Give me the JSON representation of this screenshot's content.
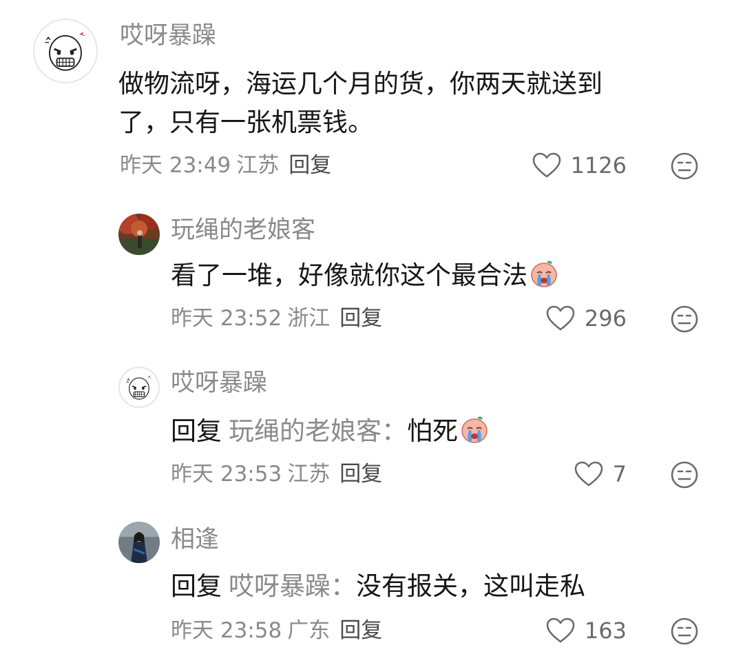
{
  "comments": [
    {
      "username": "哎呀暴躁",
      "text_line1": "做物流呀，海运几个月的货，你两天就送到",
      "text_line2": "了，只有一张机票钱。",
      "time": "昨天 23:49",
      "location": "江苏",
      "reply_label": "回复",
      "likes": "1126",
      "avatar_icon": "angry-face-sketch-avatar"
    },
    {
      "username": "玩绳的老娘客",
      "text": "看了一堆，好像就你这个最合法",
      "emoji": "crying-face-emoji",
      "time": "昨天 23:52",
      "location": "浙江",
      "reply_label": "回复",
      "likes": "296",
      "avatar_icon": "autumn-tree-photo-avatar"
    },
    {
      "username": "哎呀暴躁",
      "reply_prefix": "回复",
      "reply_target": "玩绳的老娘客：",
      "text": "怕死",
      "emoji": "crying-face-emoji",
      "time": "昨天 23:53",
      "location": "江苏",
      "reply_label": "回复",
      "likes": "7",
      "avatar_icon": "angry-face-sketch-avatar"
    },
    {
      "username": "相逢",
      "reply_prefix": "回复",
      "reply_target": "哎呀暴躁：",
      "text": "没有报关，这叫走私",
      "time": "昨天 23:58",
      "location": "广东",
      "reply_label": "回复",
      "likes": "163",
      "avatar_icon": "dark-figure-photo-avatar"
    }
  ],
  "colors": {
    "text_primary": "#161616",
    "text_secondary": "#8a8a8a",
    "icon_gray": "#6a6a6a"
  }
}
